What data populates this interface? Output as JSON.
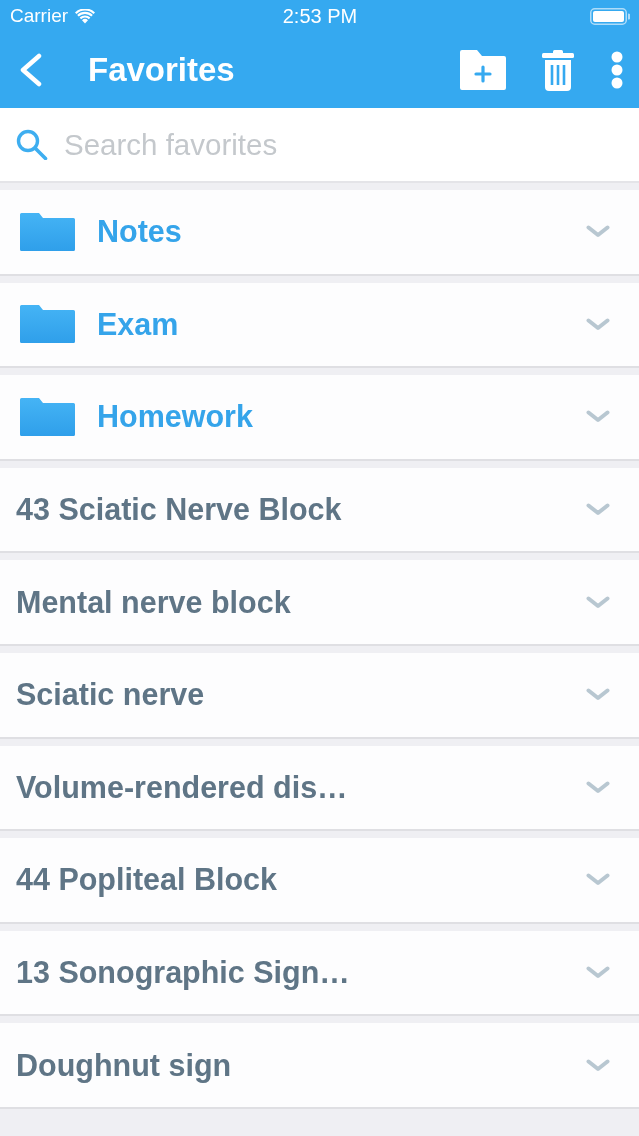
{
  "status_bar": {
    "carrier": "Carrier",
    "time": "2:53 PM"
  },
  "nav_bar": {
    "title": "Favorites"
  },
  "search": {
    "placeholder": "Search favorites"
  },
  "items": [
    {
      "kind": "folder",
      "label": "Notes"
    },
    {
      "kind": "folder",
      "label": "Exam"
    },
    {
      "kind": "folder",
      "label": "Homework"
    },
    {
      "kind": "entry",
      "label": "43 Sciatic Nerve Block"
    },
    {
      "kind": "entry",
      "label": "Mental nerve block"
    },
    {
      "kind": "entry",
      "label": "Sciatic nerve"
    },
    {
      "kind": "entry",
      "label": "Volume-rendered dis…"
    },
    {
      "kind": "entry",
      "label": "44 Popliteal Block"
    },
    {
      "kind": "entry",
      "label": "13 Sonographic Sign…"
    },
    {
      "kind": "entry",
      "label": "Doughnut sign"
    }
  ]
}
